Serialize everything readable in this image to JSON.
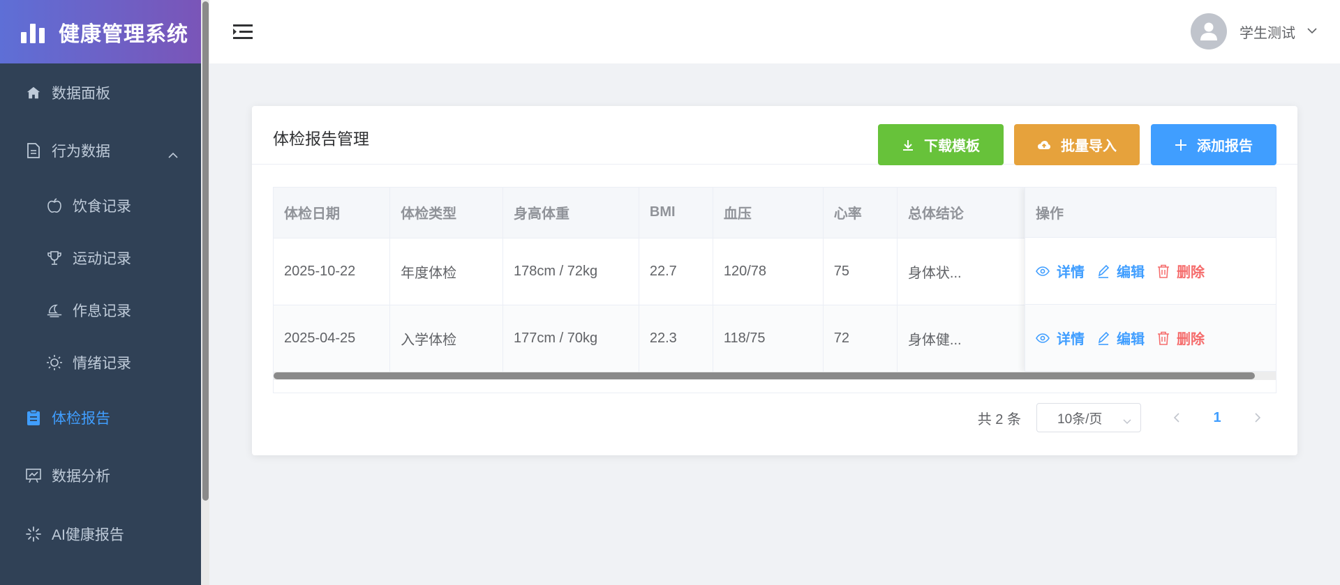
{
  "app": {
    "title": "健康管理系统"
  },
  "sidebar": {
    "items": [
      {
        "label": "数据面板",
        "icon": "home-icon"
      },
      {
        "label": "行为数据",
        "icon": "document-icon",
        "expanded": true,
        "children": [
          {
            "label": "饮食记录",
            "icon": "apple-icon"
          },
          {
            "label": "运动记录",
            "icon": "trophy-icon"
          },
          {
            "label": "作息记录",
            "icon": "moon-icon"
          },
          {
            "label": "情绪记录",
            "icon": "sun-icon"
          }
        ]
      },
      {
        "label": "体检报告",
        "icon": "clipboard-icon",
        "active": true
      },
      {
        "label": "数据分析",
        "icon": "chart-board-icon"
      },
      {
        "label": "AI健康报告",
        "icon": "loading-icon"
      }
    ]
  },
  "header": {
    "user_name": "学生测试"
  },
  "card": {
    "title": "体检报告管理",
    "buttons": {
      "download": "下载模板",
      "import": "批量导入",
      "add": "添加报告"
    }
  },
  "table": {
    "columns": [
      "体检日期",
      "体检类型",
      "身高体重",
      "BMI",
      "血压",
      "心率",
      "总体结论",
      "操作"
    ],
    "rows": [
      {
        "date": "2025-10-22",
        "type": "年度体检",
        "hw": "178cm / 72kg",
        "bmi": "22.7",
        "bp": "120/78",
        "hr": "75",
        "conclusion": "身体状..."
      },
      {
        "date": "2025-04-25",
        "type": "入学体检",
        "hw": "177cm / 70kg",
        "bmi": "22.3",
        "bp": "118/75",
        "hr": "72",
        "conclusion": "身体健..."
      }
    ],
    "actions": {
      "detail": "详情",
      "edit": "编辑",
      "delete": "删除"
    }
  },
  "pagination": {
    "total": "共 2 条",
    "page_size": "10条/页",
    "current_page": "1"
  },
  "colors": {
    "sidebar_bg": "#304156",
    "active": "#409eff",
    "green": "#67c23a",
    "orange": "#e6a23c",
    "danger": "#f56c6c"
  }
}
